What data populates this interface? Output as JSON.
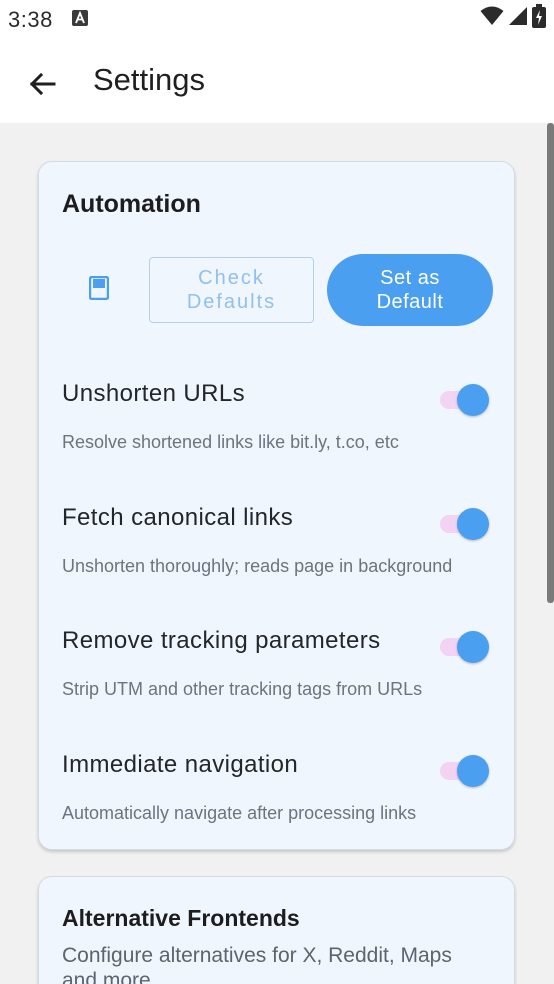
{
  "status_bar": {
    "time": "3:38",
    "notification_icon": "a-icon",
    "icons": [
      "wifi-icon",
      "signal-icon",
      "battery-icon"
    ]
  },
  "app_bar": {
    "back_icon": "arrow-back-icon",
    "title": "Settings"
  },
  "automation_card": {
    "title": "Automation",
    "book_icon": "bookmark-icon",
    "check_defaults_label": "Check\nDefaults",
    "set_default_label": "Set as\nDefault",
    "settings": [
      {
        "label": "Unshorten URLs",
        "description": "Resolve shortened links like bit.ly, t.co, etc",
        "enabled": true
      },
      {
        "label": "Fetch canonical links",
        "description": "Unshorten thoroughly; reads page in background",
        "enabled": true
      },
      {
        "label": "Remove tracking parameters",
        "description": "Strip UTM and other tracking tags from URLs",
        "enabled": true
      },
      {
        "label": "Immediate navigation",
        "description": "Automatically navigate after processing links",
        "enabled": true
      }
    ]
  },
  "frontends_card": {
    "title": "Alternative Frontends",
    "subtitle": "Configure alternatives for X, Reddit, Maps and more"
  },
  "colors": {
    "accent": "#4a9ff0",
    "toggle_track": "#f2d3f3",
    "card_background": "#f0f6fd",
    "screen_background": "#f1f1f1"
  }
}
